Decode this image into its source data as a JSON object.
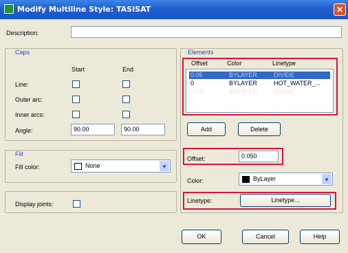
{
  "window": {
    "title": "Modify Multiline Style: TASISAT",
    "close_label": "✕"
  },
  "description": {
    "label": "Description:",
    "value": ""
  },
  "caps": {
    "title": "Caps",
    "start_header": "Start",
    "end_header": "End",
    "line_label": "Line:",
    "outer_arc_label": "Outer arc:",
    "inner_arcs_label": "Inner arcs:",
    "angle_label": "Angle:",
    "angle_start": "90.00",
    "angle_end": "90.00"
  },
  "fill": {
    "title": "Fill",
    "fill_color_label": "Fill color:",
    "fill_color_value": "None"
  },
  "display_joints": {
    "label": "Display joints:"
  },
  "elements": {
    "title": "Elements",
    "headers": {
      "offset": "Offset",
      "color": "Color",
      "linetype": "Linetype"
    },
    "rows": [
      {
        "offset": "0.05",
        "color": "BYLAYER",
        "linetype": "DIVIDE",
        "selected": true
      },
      {
        "offset": "0",
        "color": "BYLAYER",
        "linetype": "HOT_WATER_...",
        "selected": false
      },
      {
        "offset": "-0.05",
        "color": "BYLAYER",
        "linetype": "DIVIDE",
        "selected": false,
        "faded": true
      }
    ],
    "add_label": "Add",
    "delete_label": "Delete",
    "offset_label": "Offset:",
    "offset_value": "0.050",
    "color_label": "Color:",
    "color_value": "ByLayer",
    "linetype_label": "Linetype:",
    "linetype_button": "Linetype..."
  },
  "buttons": {
    "ok": "OK",
    "cancel": "Cancel",
    "help": "Help"
  },
  "colors": {
    "title_bar": "#1f5fcf",
    "highlight_box": "#d9143a",
    "group_title": "#1d4fb8",
    "selection": "#3169c6"
  }
}
